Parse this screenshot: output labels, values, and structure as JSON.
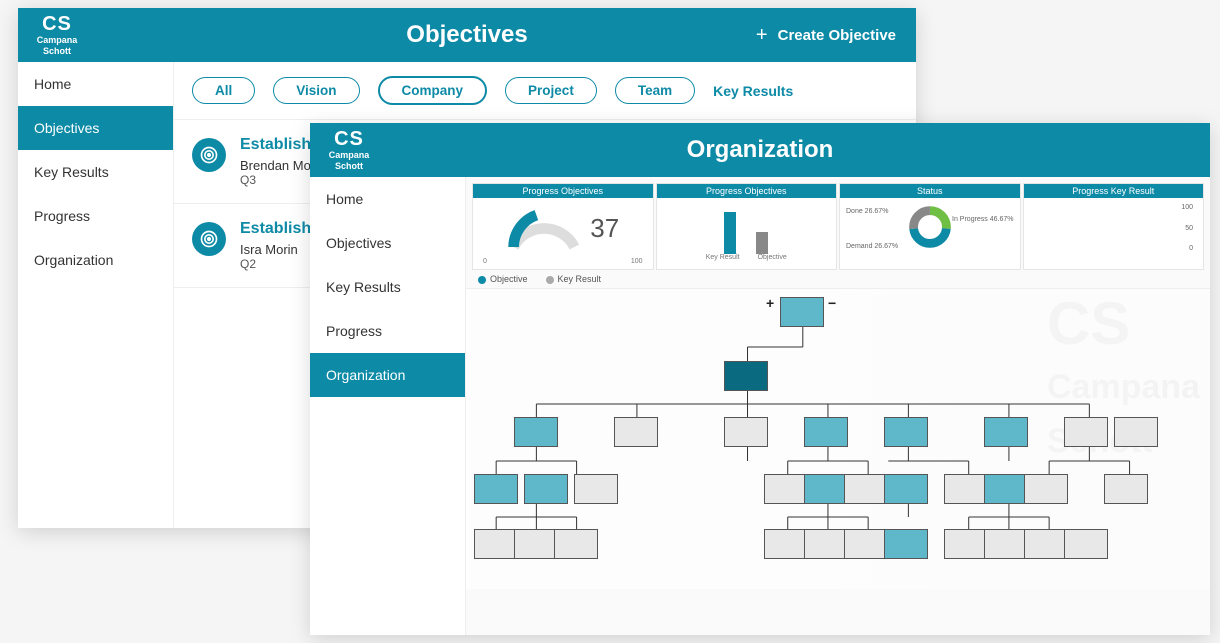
{
  "brand": {
    "logo": "CS",
    "sub1": "Campana",
    "sub2": "Schott"
  },
  "back": {
    "header_title": "Objectives",
    "create_label": "Create Objective",
    "sidebar": [
      {
        "label": "Home"
      },
      {
        "label": "Objectives",
        "active": true
      },
      {
        "label": "Key Results"
      },
      {
        "label": "Progress"
      },
      {
        "label": "Organization"
      }
    ],
    "tabs": [
      {
        "label": "All"
      },
      {
        "label": "Vision"
      },
      {
        "label": "Company",
        "active": true
      },
      {
        "label": "Project"
      },
      {
        "label": "Team"
      }
    ],
    "tab_link": "Key Results",
    "list": [
      {
        "title": "Establish int",
        "owner": "Brendan Morgan",
        "q": "Q3"
      },
      {
        "title": "Establish Ex",
        "owner": "Isra Morin",
        "q": "Q2"
      }
    ]
  },
  "front": {
    "header_title": "Organization",
    "sidebar": [
      {
        "label": "Home"
      },
      {
        "label": "Objectives"
      },
      {
        "label": "Key Results"
      },
      {
        "label": "Progress"
      },
      {
        "label": "Organization",
        "active": true
      }
    ],
    "cards": {
      "gauge": {
        "title": "Progress Objectives",
        "value": 37,
        "min": "0",
        "max": "100"
      },
      "bars": {
        "title": "Progress Objectives",
        "labels": [
          "Key Result",
          "Objective"
        ]
      },
      "status": {
        "title": "Status",
        "done": "Done 26.67%",
        "progress": "In Progress 46.67%",
        "demand": "Demand 26.67%"
      },
      "keyresult": {
        "title": "Progress Key Result",
        "ticks": [
          "100",
          "50",
          "0"
        ]
      }
    },
    "legend": {
      "a": "Objective",
      "b": "Key Result"
    },
    "expand": {
      "plus": "+",
      "minus": "−"
    }
  },
  "chart_data": [
    {
      "type": "bar",
      "title": "Progress Objectives (gauge)",
      "categories": [
        "Progress"
      ],
      "values": [
        37
      ],
      "ylim": [
        0,
        100
      ]
    },
    {
      "type": "bar",
      "title": "Progress Objectives",
      "categories": [
        "Key Result",
        "Objective"
      ],
      "values": [
        60,
        30
      ]
    },
    {
      "type": "pie",
      "title": "Status",
      "series": [
        {
          "name": "Done",
          "values": [
            26.67
          ]
        },
        {
          "name": "In Progress",
          "values": [
            46.67
          ]
        },
        {
          "name": "Demand",
          "values": [
            26.67
          ]
        }
      ]
    },
    {
      "type": "bar",
      "title": "Progress Key Result",
      "categories": [],
      "values": [],
      "ylim": [
        0,
        100
      ]
    }
  ]
}
